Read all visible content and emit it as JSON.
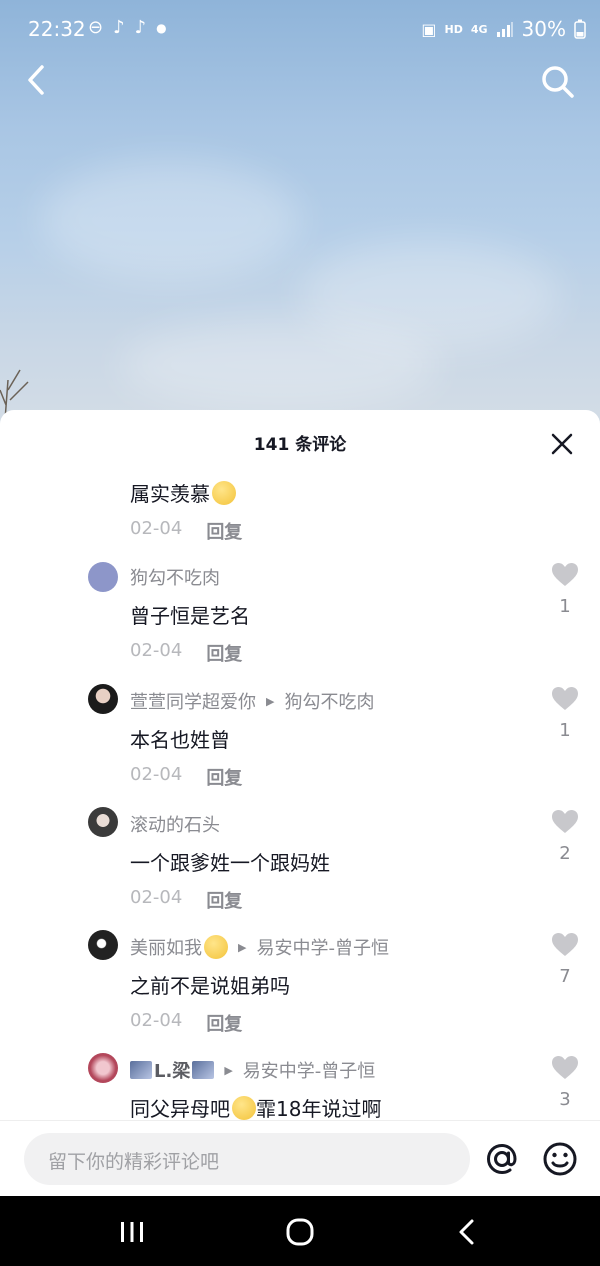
{
  "status_bar": {
    "time": "22:32",
    "network": "HD",
    "signal_label": "4G",
    "battery": "30%"
  },
  "sheet": {
    "title": "141 条评论"
  },
  "comments": [
    {
      "user": "",
      "reply_to": "",
      "text": "属实羡慕",
      "date": "02-04",
      "reply_label": "回复",
      "likes": ""
    },
    {
      "user": "狗勾不吃肉",
      "reply_to": "",
      "text": "曾子恒是艺名",
      "date": "02-04",
      "reply_label": "回复",
      "likes": "1"
    },
    {
      "user": "萱萱同学超爱你",
      "reply_to": "狗勾不吃肉",
      "text": "本名也姓曾",
      "date": "02-04",
      "reply_label": "回复",
      "likes": "1"
    },
    {
      "user": "滚动的石头",
      "reply_to": "",
      "text": "一个跟爹姓一个跟妈姓",
      "date": "02-04",
      "reply_label": "回复",
      "likes": "2"
    },
    {
      "user": "美丽如我",
      "reply_to": "易安中学-曾子恒",
      "text": "之前不是说姐弟吗",
      "date": "02-04",
      "reply_label": "回复",
      "likes": "7"
    },
    {
      "user": "L.梁",
      "reply_to": "易安中学-曾子恒",
      "text_before": "同父异母吧",
      "text_after": "霏18年说过啊",
      "likes": "3"
    }
  ],
  "input": {
    "placeholder": "留下你的精彩评论吧"
  },
  "colors": {
    "primary_text": "#161823",
    "secondary_text": "#8a8b91",
    "muted_text": "#b7b8bc",
    "like_icon": "#c8c8cc"
  }
}
